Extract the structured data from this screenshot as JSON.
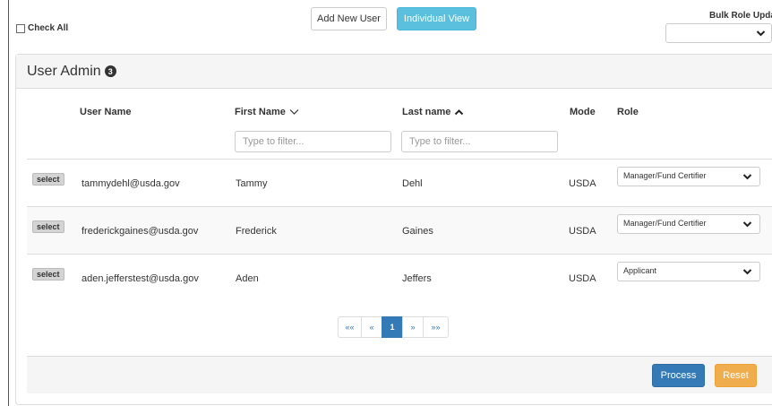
{
  "toolbar": {
    "check_all_label": "Check All",
    "add_user_label": "Add New User",
    "individual_view_label": "Individual View",
    "bulk_role_label": "Bulk Role Updat",
    "bulk_role_value": ""
  },
  "panel": {
    "title": "User Admin",
    "count": "3"
  },
  "columns": {
    "user_name": "User Name",
    "first_name": "First Name",
    "last_name": "Last name",
    "mode": "Mode",
    "role": "Role",
    "first_name_sort": "descending",
    "last_name_sort": "ascending"
  },
  "filters": {
    "first_name_placeholder": "Type to filter...",
    "last_name_placeholder": "Type to filter..."
  },
  "rows": [
    {
      "select_label": "select",
      "user_name": "tammydehl@usda.gov",
      "first_name": "Tammy",
      "last_name": "Dehl",
      "mode": "USDA",
      "role": "Manager/Fund Certifier"
    },
    {
      "select_label": "select",
      "user_name": "frederickgaines@usda.gov",
      "first_name": "Frederick",
      "last_name": "Gaines",
      "mode": "USDA",
      "role": "Manager/Fund Certifier"
    },
    {
      "select_label": "select",
      "user_name": "aden.jefferstest@usda.gov",
      "first_name": "Aden",
      "last_name": "Jeffers",
      "mode": "USDA",
      "role": "Applicant"
    }
  ],
  "pagination": {
    "first": "««",
    "prev": "«",
    "current": "1",
    "next": "»",
    "last": "»»"
  },
  "footer": {
    "process_label": "Process",
    "reset_label": "Reset"
  },
  "colors": {
    "info": "#5bc0de",
    "primary": "#337ab7",
    "warning": "#f0ad4e"
  }
}
